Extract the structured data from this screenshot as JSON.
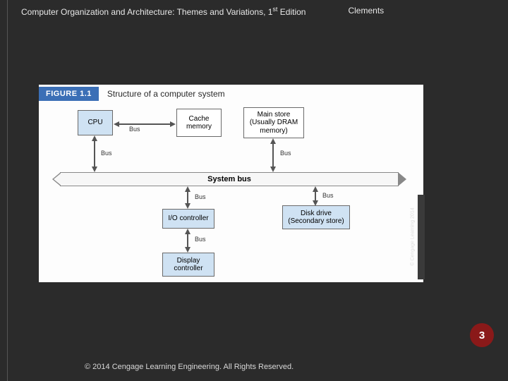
{
  "header": {
    "title_pre": "Computer Organization and Architecture: Themes and Variations, 1",
    "title_sup": "st",
    "title_post": " Edition",
    "author": "Clements"
  },
  "figure": {
    "tag": "FIGURE 1.1",
    "caption": "Structure of a computer system",
    "blocks": {
      "cpu": "CPU",
      "cache": "Cache\nmemory",
      "main": "Main store\n(Usually DRAM\nmemory)",
      "io": "I/O controller",
      "disk": "Disk drive\n(Secondary store)",
      "display": "Display\ncontroller",
      "system_bus": "System bus"
    },
    "bus_label": "Bus",
    "image_credit": "© Cengage Learning 2014"
  },
  "page_number": "3",
  "footer": "© 2014 Cengage Learning Engineering. All Rights Reserved."
}
